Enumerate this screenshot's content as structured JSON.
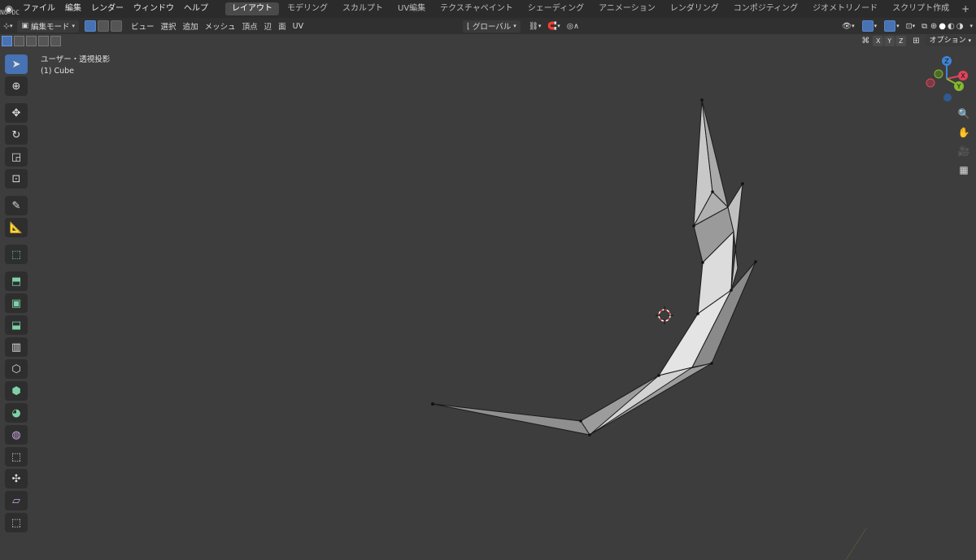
{
  "topbar": {
    "menu": [
      "ファイル",
      "編集",
      "レンダー",
      "ウィンドウ",
      "ヘルプ"
    ],
    "workspaces": [
      "レイアウト",
      "モデリング",
      "スカルプト",
      "UV編集",
      "テクスチャペイント",
      "シェーディング",
      "アニメーション",
      "レンダリング",
      "コンポジティング",
      "ジオメトリノード",
      "スクリプト作成"
    ],
    "active_workspace": "レイアウト",
    "corner_text": "NO DC"
  },
  "header": {
    "mode_label": "編集モード",
    "menus": [
      "ビュー",
      "選択",
      "追加",
      "メッシュ",
      "頂点",
      "辺",
      "面",
      "UV"
    ],
    "transform_orientation": "グローバル"
  },
  "header3": {
    "axes": [
      "X",
      "Y",
      "Z"
    ],
    "options_label": "オプション"
  },
  "viewport": {
    "view_name": "ユーザー・透視投影",
    "object_name": "(1) Cube"
  },
  "gizmo": {
    "z_label": "Z",
    "x_label": "X",
    "y_label": "Y"
  },
  "colors": {
    "accent": "#4772b3",
    "x_axis": "#e0445a",
    "y_axis": "#86b92f",
    "z_axis": "#3e84d6"
  }
}
